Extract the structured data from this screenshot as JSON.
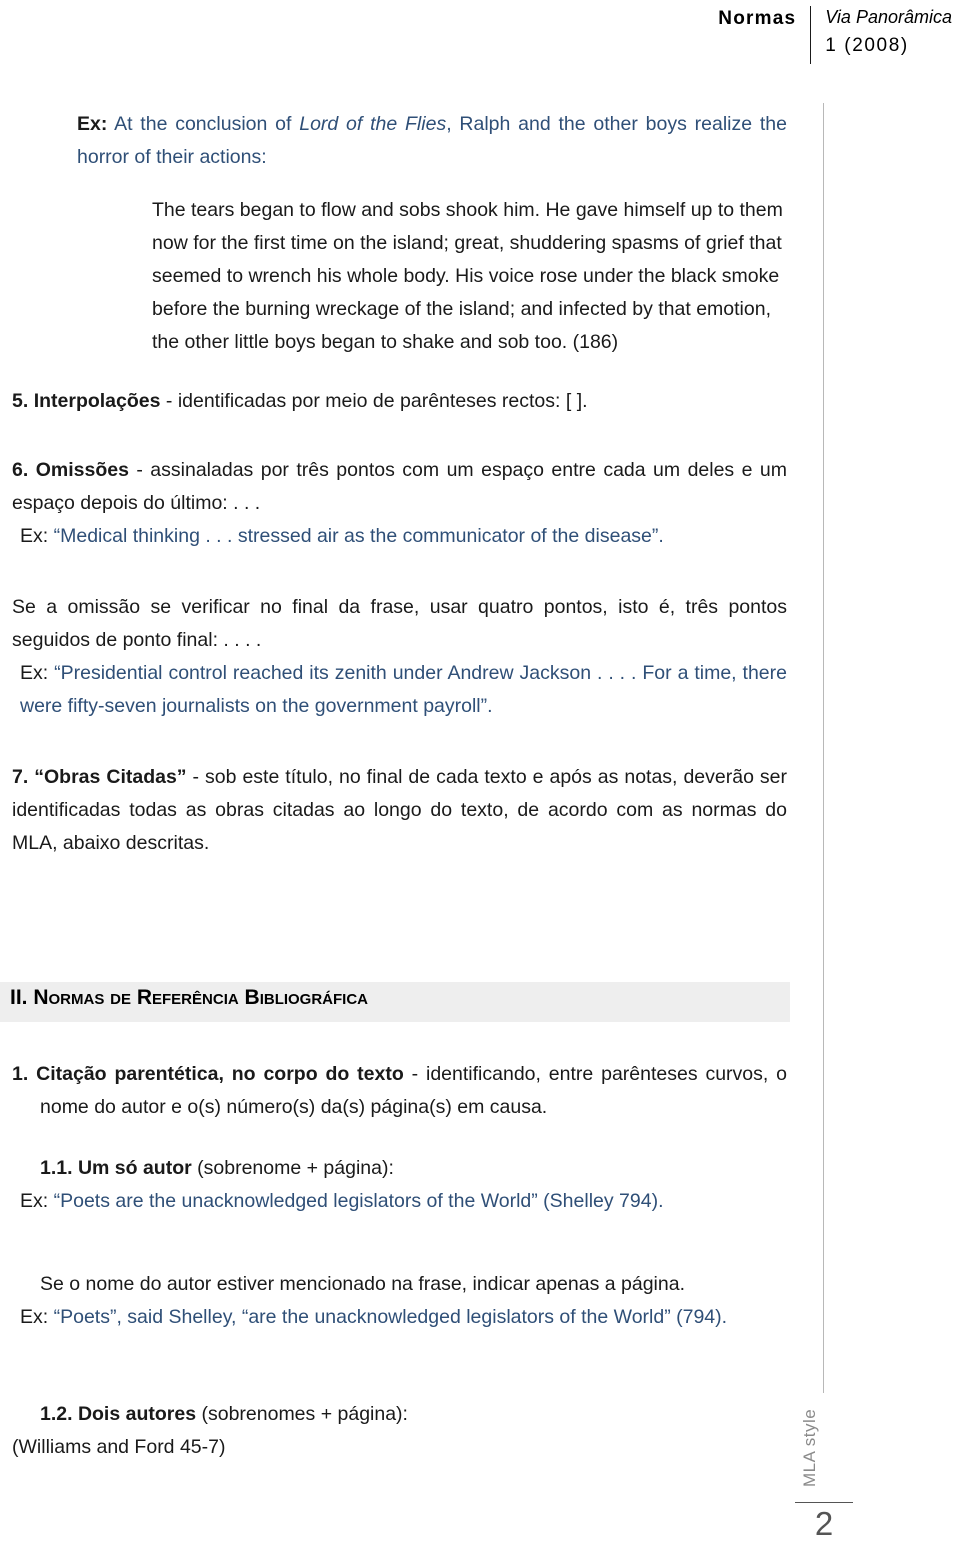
{
  "header": {
    "left_label": "Normas",
    "journal_name": "Via Panorâmica",
    "issue": "1 (2008)"
  },
  "footer": {
    "side_label": "MLA style",
    "page_number": "2"
  },
  "body": {
    "ex_top": {
      "prefix": "Ex:",
      "text_before": " At the conclusion of ",
      "italic_title": "Lord of the Flies",
      "text_after": ", Ralph and the other boys realize the horror of their actions:"
    },
    "quote_block": "The tears began to flow and sobs shook him. He gave himself up to them now for the first time on the island; great, shuddering spasms of grief that seemed to wrench his whole body. His voice rose under the black smoke before the burning wreckage of the island; and infected by that emotion, the other little boys began to shake and sob too. (186)",
    "item_5": {
      "number": "5.",
      "bold_term": "Interpolações",
      "rest": " - identificadas por meio de parênteses rectos: [ ]."
    },
    "item_6": {
      "number": "6.",
      "bold_term": "Omissões",
      "rest": " - assinaladas por três pontos com um espaço entre cada um deles e um espaço depois do último: . . .",
      "example_prefix": "Ex:",
      "example_text": " “Medical thinking . . . stressed air as the communicator of the disease”."
    },
    "omission_final": {
      "paragraph": "Se a omissão se verificar no final da frase, usar quatro pontos, isto é, três pontos seguidos de ponto final: . . . .",
      "example_prefix": "Ex:",
      "example_text": " “Presidential control reached its zenith under Andrew Jackson . . . . For a time, there were fifty-seven journalists on the government payroll”."
    },
    "item_7": {
      "number": "7.",
      "bold_term": "“Obras Citadas”",
      "rest": " - sob este título, no final de cada texto e após as notas, deverão ser identificadas todas as obras citadas ao longo do texto, de acordo com as normas do MLA, abaixo descritas."
    },
    "section_heading": {
      "number": "II. ",
      "title": "Normas de Referência Bibliográfica"
    },
    "item_b1": {
      "number": "1.",
      "bold_term": "Citação parentética, no corpo do texto",
      "rest": " - identificando, entre parênteses curvos, o nome do autor e o(s) número(s) da(s) página(s) em causa."
    },
    "item_b11": {
      "bold_term": "1.1. Um só autor",
      "rest": " (sobrenome + página):",
      "example_prefix": "Ex:",
      "example_text": " “Poets are the unacknowledged legislators of the World” (Shelley 794)."
    },
    "author_mentioned": {
      "paragraph": "Se o nome do autor estiver mencionado na frase, indicar apenas a página.",
      "example_prefix": "Ex:",
      "example_text": " “Poets”, said Shelley, “are the unacknowledged legislators of the World” (794)."
    },
    "item_b12": {
      "bold_term": "1.2. Dois autores",
      "rest": " (sobrenomes + página):",
      "example_text": "(Williams and Ford 45-7)"
    }
  },
  "colors": {
    "quote_blue": "#2f4f77",
    "text_black": "#1a1a1a",
    "band_gray": "#eeeeee",
    "rule_gray": "#b8b8b8",
    "footer_gray": "#8a8a8a"
  }
}
